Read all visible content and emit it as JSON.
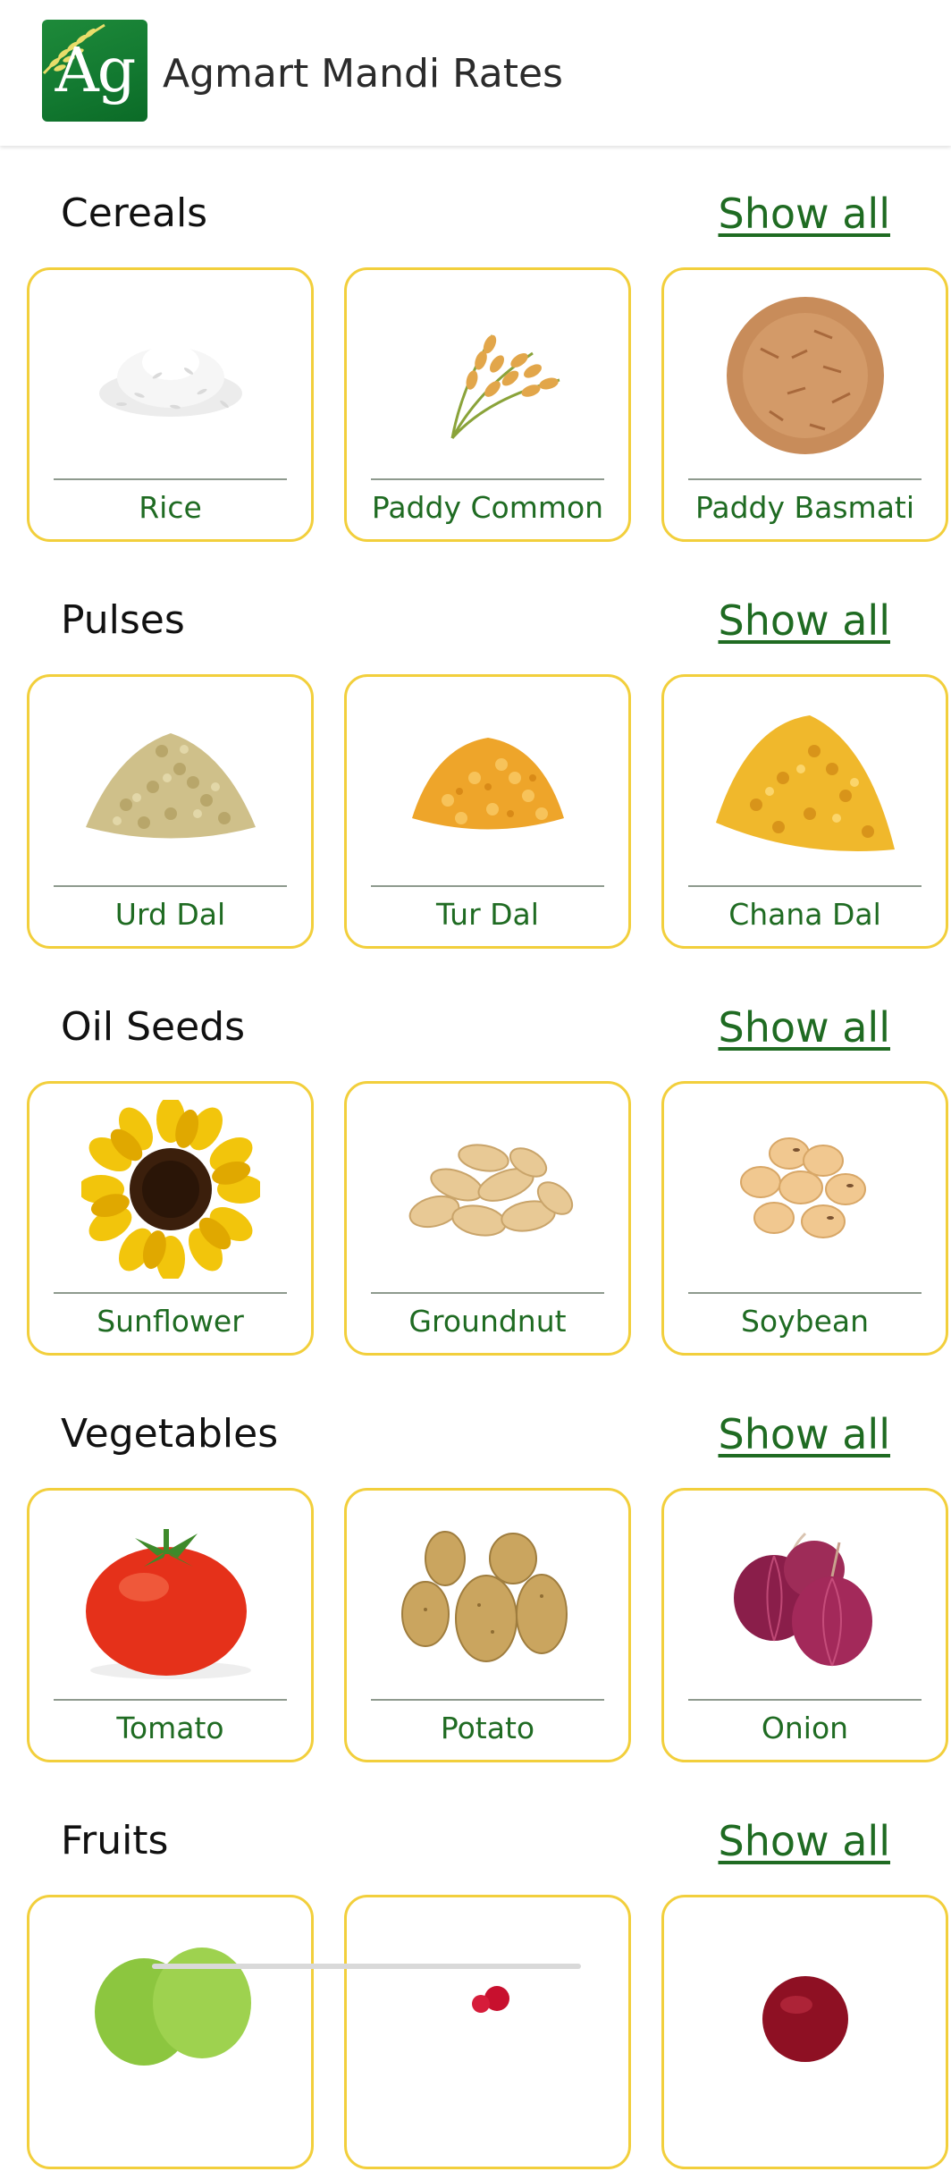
{
  "app": {
    "title": "Agmart Mandi Rates",
    "logo_text": "Ag"
  },
  "sections": [
    {
      "title": "Cereals",
      "show_all": "Show all",
      "items": [
        {
          "label": "Rice",
          "icon": "rice-icon"
        },
        {
          "label": "Paddy Common",
          "icon": "paddy-icon"
        },
        {
          "label": "Paddy Basmati",
          "icon": "paddy-basmati-icon"
        }
      ]
    },
    {
      "title": "Pulses",
      "show_all": "Show all",
      "items": [
        {
          "label": "Urd Dal",
          "icon": "urd-dal-icon"
        },
        {
          "label": "Tur Dal",
          "icon": "tur-dal-icon"
        },
        {
          "label": "Chana Dal",
          "icon": "chana-dal-icon"
        }
      ]
    },
    {
      "title": "Oil Seeds",
      "show_all": "Show all",
      "items": [
        {
          "label": "Sunflower",
          "icon": "sunflower-icon"
        },
        {
          "label": "Groundnut",
          "icon": "groundnut-icon"
        },
        {
          "label": "Soybean",
          "icon": "soybean-icon"
        }
      ]
    },
    {
      "title": "Vegetables",
      "show_all": "Show all",
      "items": [
        {
          "label": "Tomato",
          "icon": "tomato-icon"
        },
        {
          "label": "Potato",
          "icon": "potato-icon"
        },
        {
          "label": "Onion",
          "icon": "onion-icon"
        }
      ]
    },
    {
      "title": "Fruits",
      "show_all": "Show all",
      "items": [
        {
          "label": "",
          "icon": "apple-icon"
        },
        {
          "label": "",
          "icon": "cherry-icon"
        },
        {
          "label": "",
          "icon": "red-apple-icon"
        }
      ]
    }
  ],
  "colors": {
    "accent_green": "#1f6b22",
    "card_border": "#f2cf3c",
    "logo_green": "#137a31"
  }
}
